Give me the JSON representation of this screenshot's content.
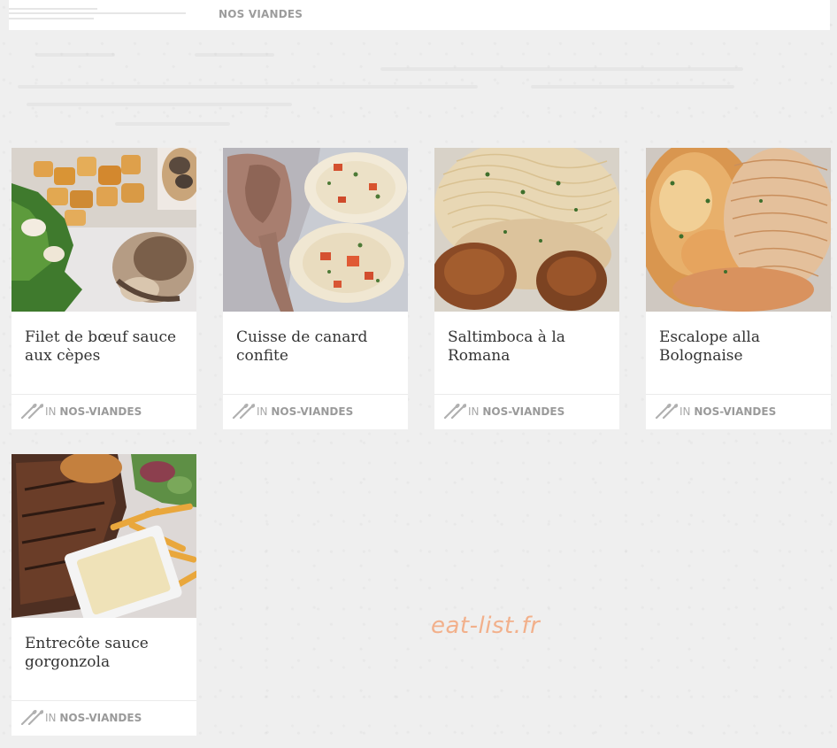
{
  "breadcrumb": {
    "label": "NOS VIANDES"
  },
  "cards": [
    {
      "title": "Filet de bœuf sauce aux cèpes",
      "in_label": "IN",
      "category": "NOS-VIANDES",
      "photo": "roast-potatoes-beef-salad"
    },
    {
      "title": "Cuisse de canard confite",
      "in_label": "IN",
      "category": "NOS-VIANDES",
      "photo": "duck-leg-mashed-potatoes"
    },
    {
      "title": "Saltimboca à la Romana",
      "in_label": "IN",
      "category": "NOS-VIANDES",
      "photo": "spaghetti-veal-cutlets"
    },
    {
      "title": "Escalope alla Bolognaise",
      "in_label": "IN",
      "category": "NOS-VIANDES",
      "photo": "escalope-cheese-spaghetti"
    },
    {
      "title": "Entrecôte sauce gorgonzola",
      "in_label": "IN",
      "category": "NOS-VIANDES",
      "photo": "grilled-steak-fries-sauce"
    }
  ],
  "watermark": "eat-list.fr"
}
